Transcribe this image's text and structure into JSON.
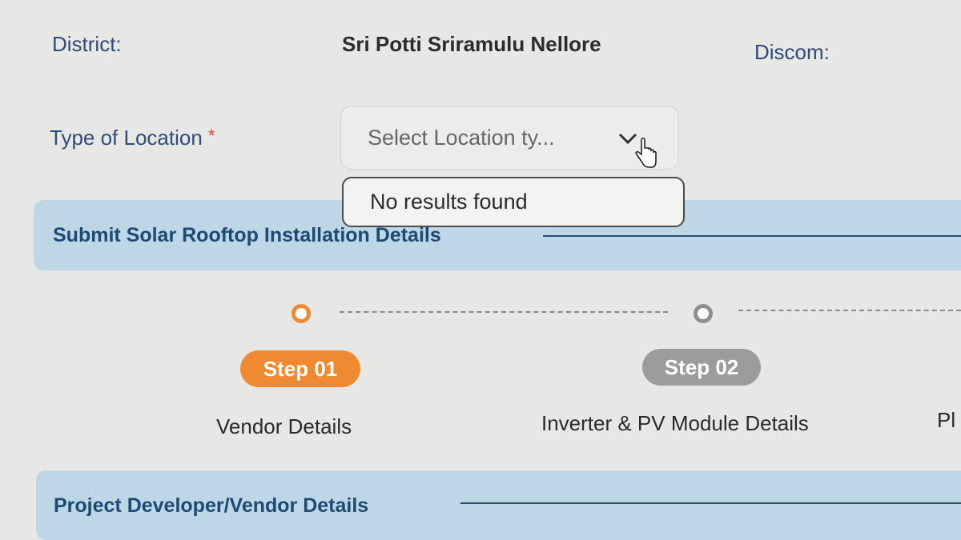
{
  "form": {
    "district_label": "District:",
    "district_value": "Sri Potti Sriramulu Nellore",
    "discom_label": "Discom:",
    "location_type_label": "Type of Location",
    "required_marker": "*",
    "location_select": {
      "placeholder": "Select Location ty...",
      "dropdown_message": "No results found"
    }
  },
  "sections": {
    "submit_title": "Submit Solar Rooftop Installation Details",
    "vendor_title": "Project Developer/Vendor Details"
  },
  "steps": [
    {
      "pill": "Step 01",
      "caption": "Vendor Details",
      "state": "active"
    },
    {
      "pill": "Step 02",
      "caption": "Inverter & PV Module Details",
      "state": "inactive"
    },
    {
      "pill": "",
      "caption": "Pl",
      "state": "inactive"
    }
  ],
  "colors": {
    "accent_orange": "#f08a32",
    "inactive_gray": "#9c9c9c",
    "label_blue": "#2f4d78",
    "banner_bg": "#bed7e7"
  },
  "icons": {
    "select_arrow": "chevron-down-icon",
    "cursor": "hand-pointer-icon"
  }
}
